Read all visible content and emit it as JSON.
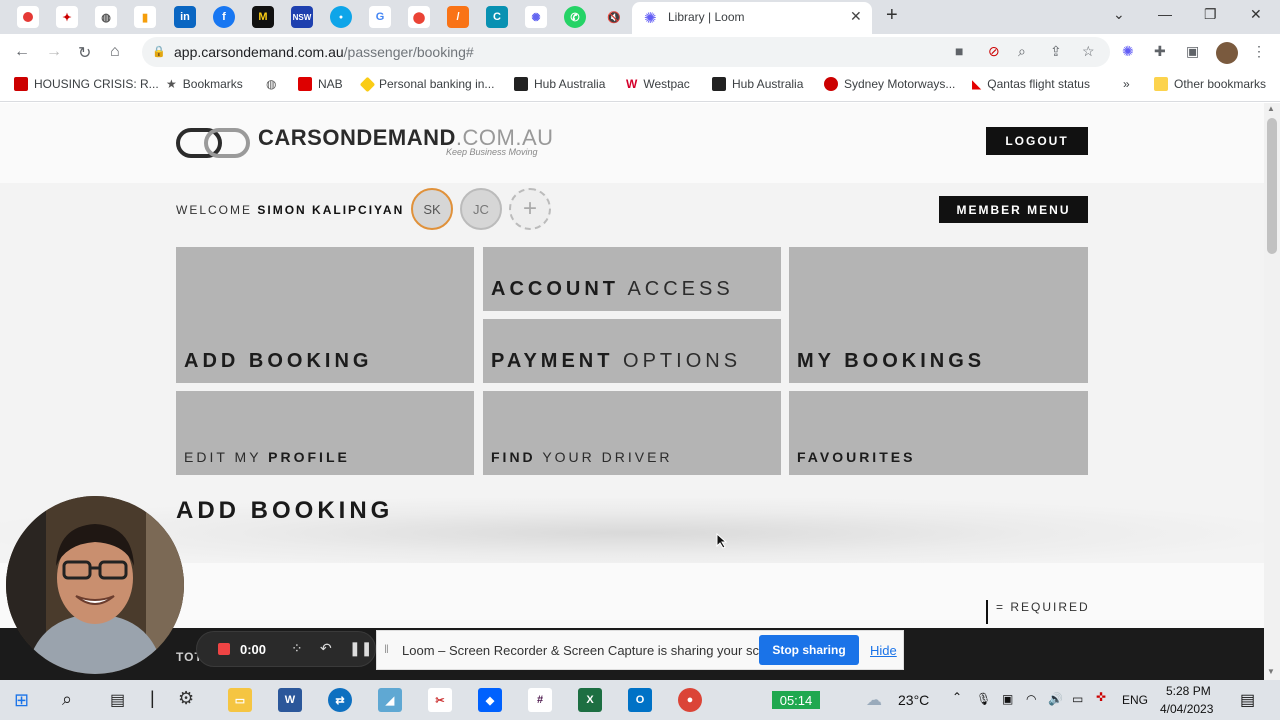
{
  "browser": {
    "active_tab_title": "Library | Loom",
    "url_host": "app.carsondemand.com.au",
    "url_path": "/passenger/booking#",
    "bookmarks": [
      "HOUSING CRISIS: R...",
      "Bookmarks",
      "NAB",
      "Personal banking in...",
      "Hub Australia",
      "Westpac",
      "Hub Australia",
      "Sydney Motorways...",
      "Qantas flight status"
    ],
    "bookmarks_overflow": "»",
    "other_bookmarks": "Other bookmarks"
  },
  "site": {
    "logo_bold": "CARSONDEMAND",
    "logo_light": ".COM.AU",
    "tagline": "Keep Business Moving",
    "logout_label": "LOGOUT",
    "welcome_prefix": "WELCOME",
    "user_name": "SIMON KALIPCIYAN",
    "avatars": [
      "SK",
      "JC",
      "+"
    ],
    "member_menu_label": "MEMBER MENU",
    "tiles": {
      "add_booking": "ADD BOOKING",
      "account_bold": "ACCOUNT",
      "account_light": "ACCESS",
      "payment_bold": "PAYMENT",
      "payment_light": "OPTIONS",
      "my_bookings": "MY BOOKINGS",
      "edit_light": "EDIT MY",
      "edit_bold": "PROFILE",
      "find_bold": "FIND",
      "find_light": "YOUR DRIVER",
      "favourites": "FAVOURITES"
    },
    "section_title": "ADD BOOKING",
    "required_label": "= REQUIRED",
    "total_partial": "TOT"
  },
  "loom": {
    "timer": "0:00",
    "share_text": "Loom – Screen Recorder & Screen Capture is sharing your screen.",
    "stop_label": "Stop sharing",
    "hide_label": "Hide"
  },
  "taskbar": {
    "counter": "05:14",
    "temperature": "23°C",
    "language": "ENG",
    "time": "5:28 PM",
    "date": "4/04/2023"
  },
  "colors": {
    "accent_orange": "#e0913a",
    "loom_blue": "#1a73e8",
    "tile_gray": "#b4b4b4"
  }
}
